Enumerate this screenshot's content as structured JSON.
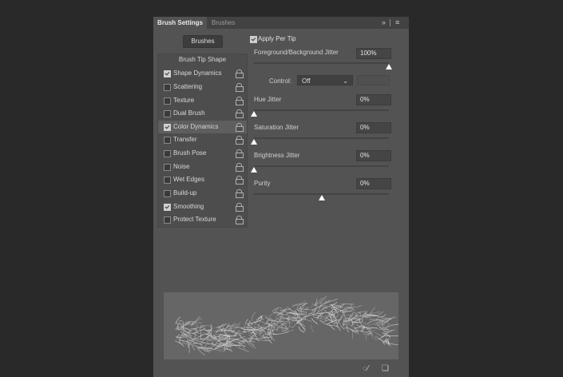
{
  "tabs": {
    "active": "Brush Settings",
    "inactive": "Brushes",
    "expand_icon": "double-chevron-right-icon",
    "menu_icon": "hamburger-menu-icon"
  },
  "left": {
    "brushes_button": "Brushes",
    "tip_shape": "Brush Tip Shape",
    "items": [
      {
        "label": "Shape Dynamics",
        "checked": true,
        "selected": false
      },
      {
        "label": "Scattering",
        "checked": false,
        "selected": false
      },
      {
        "label": "Texture",
        "checked": false,
        "selected": false
      },
      {
        "label": "Dual Brush",
        "checked": false,
        "selected": false
      },
      {
        "label": "Color Dynamics",
        "checked": true,
        "selected": true
      },
      {
        "label": "Transfer",
        "checked": false,
        "selected": false
      },
      {
        "label": "Brush Pose",
        "checked": false,
        "selected": false
      },
      {
        "label": "Noise",
        "checked": false,
        "selected": false
      },
      {
        "label": "Wet Edges",
        "checked": false,
        "selected": false
      },
      {
        "label": "Build-up",
        "checked": false,
        "selected": false
      },
      {
        "label": "Smoothing",
        "checked": true,
        "selected": false
      },
      {
        "label": "Protect Texture",
        "checked": false,
        "selected": false
      }
    ]
  },
  "right": {
    "apply_per_tip": {
      "label": "Apply Per Tip",
      "checked": true
    },
    "fg_bg_jitter": {
      "label": "Foreground/Background Jitter",
      "value": "100%",
      "level": 1.0
    },
    "control": {
      "label": "Control:",
      "value": "Off"
    },
    "hue_jitter": {
      "label": "Hue Jitter",
      "value": "0%",
      "level": 0.0
    },
    "saturation_jitter": {
      "label": "Saturation Jitter",
      "value": "0%",
      "level": 0.0
    },
    "brightness_jitter": {
      "label": "Brightness Jitter",
      "value": "0%",
      "level": 0.0
    },
    "purity": {
      "label": "Purity",
      "value": "0%",
      "level": 0.5
    }
  },
  "colors": {
    "background": "#292929",
    "panel": "#535353",
    "tabbar": "#424242",
    "preview": "#666666"
  },
  "bottom": {
    "icons": [
      "toggle-live-tip-preview-icon",
      "create-new-brush-icon"
    ]
  }
}
